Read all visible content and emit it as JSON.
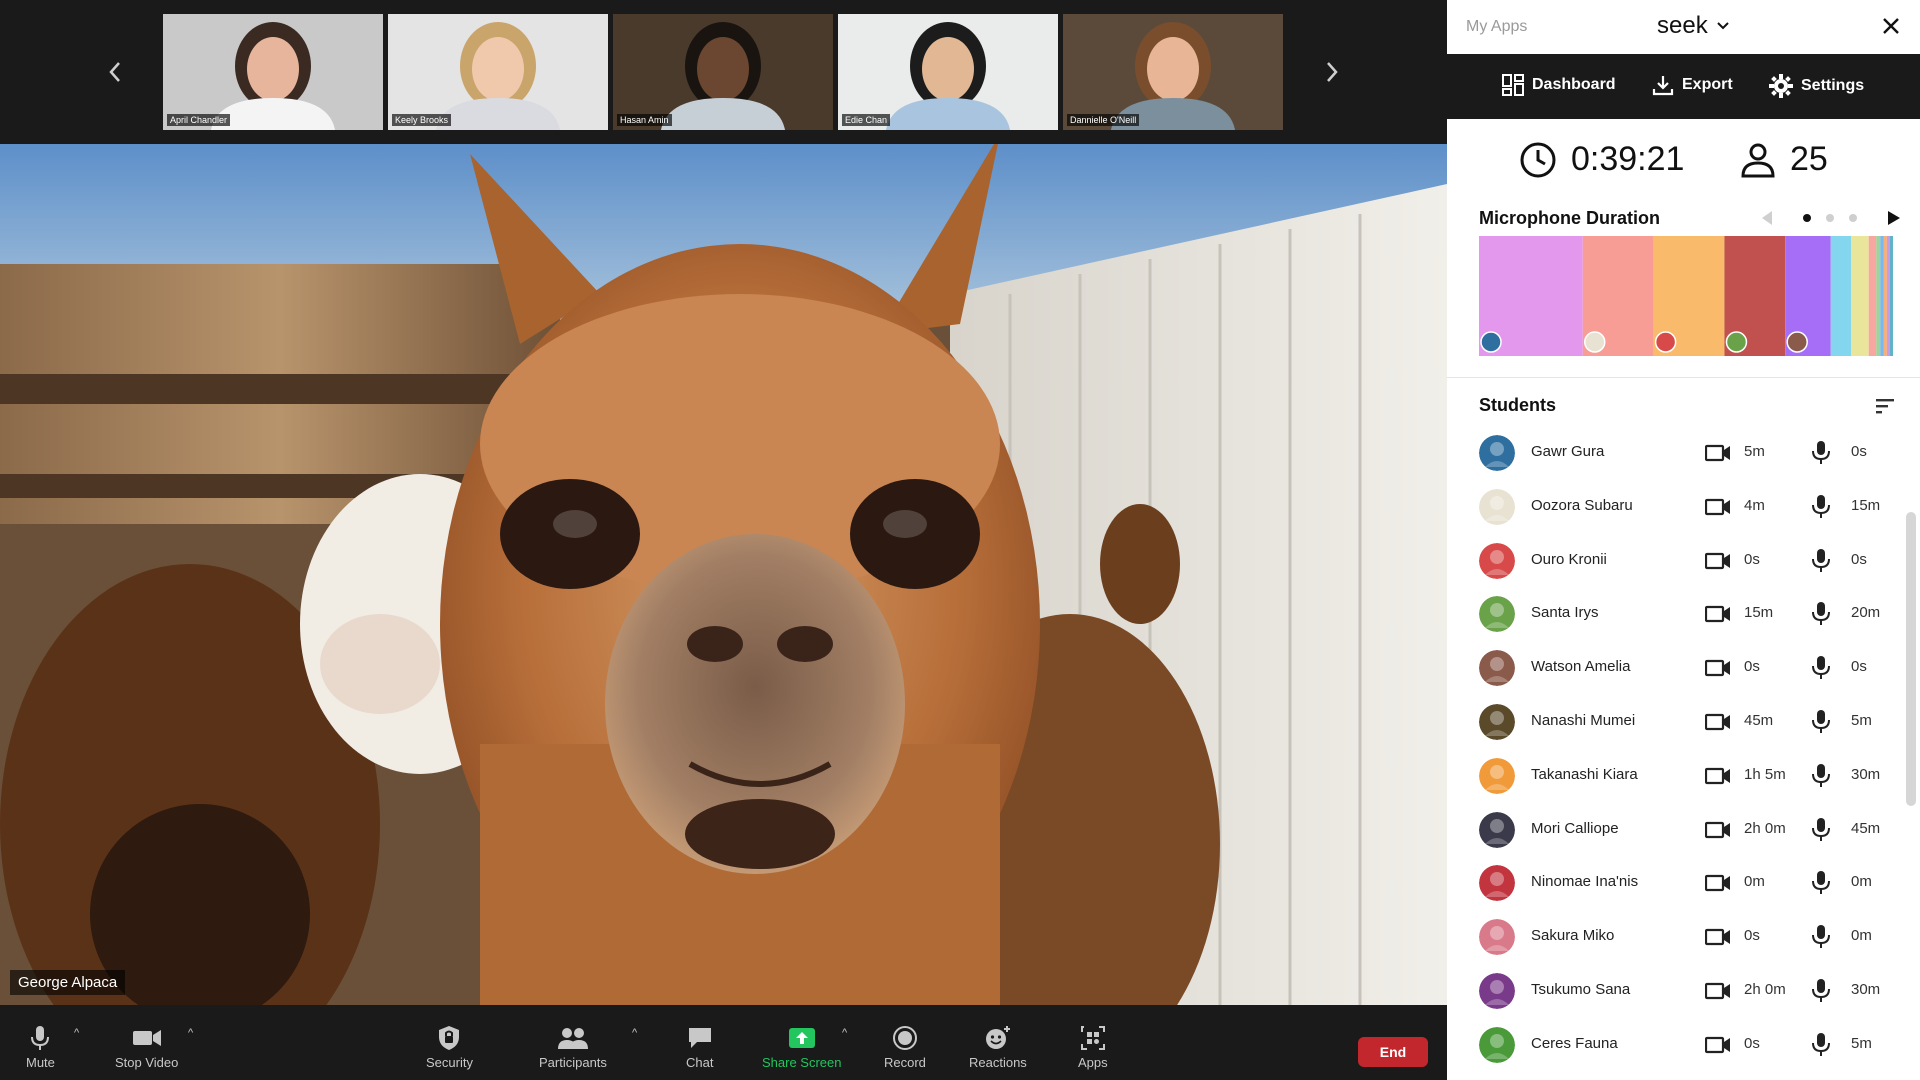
{
  "thumbnails": {
    "prev_icon": "chevron-left-icon",
    "next_icon": "chevron-right-icon",
    "items": [
      {
        "name": "April Chandler",
        "bg": "#c9c9c9",
        "hair": "#3a2a22",
        "skin": "#e6b59c",
        "shirt": "#f4f4f4"
      },
      {
        "name": "Keely Brooks",
        "bg": "#e4e4e4",
        "hair": "#c9a46b",
        "skin": "#f0c8ac",
        "shirt": "#d9dbe0"
      },
      {
        "name": "Hasan Amin",
        "bg": "#4a3a2c",
        "hair": "#1a1410",
        "skin": "#6b4630",
        "shirt": "#c7cfd6"
      },
      {
        "name": "Edie Chan",
        "bg": "#e9ecea",
        "hair": "#1c1c1c",
        "skin": "#e2b794",
        "shirt": "#a9c4df"
      },
      {
        "name": "Dannielle O'Neill",
        "bg": "#5b4a3a",
        "hair": "#7a4e2c",
        "skin": "#e8b597",
        "shirt": "#7b909c"
      }
    ]
  },
  "main_video": {
    "speaker": "George Alpaca"
  },
  "toolbar": {
    "mute": {
      "label": "Mute",
      "icon": "microphone-icon"
    },
    "stop_video": {
      "label": "Stop Video",
      "icon": "video-camera-icon"
    },
    "security": {
      "label": "Security",
      "icon": "shield-icon"
    },
    "participants": {
      "label": "Participants",
      "icon": "participants-icon"
    },
    "chat": {
      "label": "Chat",
      "icon": "chat-icon"
    },
    "share_screen": {
      "label": "Share Screen",
      "icon": "share-screen-icon",
      "color": "#22c55e"
    },
    "record": {
      "label": "Record",
      "icon": "record-icon"
    },
    "reactions": {
      "label": "Reactions",
      "icon": "smiley-icon"
    },
    "apps": {
      "label": "Apps",
      "icon": "apps-icon"
    },
    "end": {
      "label": "End",
      "color": "#c1272d"
    }
  },
  "panel": {
    "my_apps": "My Apps",
    "app_name": "seek",
    "nav": {
      "dashboard": "Dashboard",
      "export": "Export",
      "settings": "Settings"
    },
    "stats": {
      "elapsed": "0:39:21",
      "participants": "25"
    },
    "microphone_duration": {
      "title": "Microphone Duration",
      "active_page": 0,
      "pages": 3
    },
    "students_title": "Students"
  },
  "chart_data": {
    "type": "bar",
    "title": "Microphone Duration",
    "series": [
      {
        "share": 0.205,
        "color": "#e398ee"
      },
      {
        "share": 0.14,
        "color": "#f89d96"
      },
      {
        "share": 0.14,
        "color": "#f9bb6b"
      },
      {
        "share": 0.12,
        "color": "#c1514f"
      },
      {
        "share": 0.09,
        "color": "#a66ef6"
      },
      {
        "share": 0.04,
        "color": "#84d6ee"
      },
      {
        "share": 0.035,
        "color": "#e9e59a"
      },
      {
        "share": 0.015,
        "color": "#f7a6a0"
      },
      {
        "share": 0.008,
        "color": "#9bd49c"
      },
      {
        "share": 0.007,
        "color": "#7cb7f0"
      },
      {
        "share": 0.006,
        "color": "#f5b07a"
      },
      {
        "share": 0.006,
        "color": "#c79be8"
      },
      {
        "share": 0.006,
        "color": "#5fb4c8"
      }
    ]
  },
  "students": [
    {
      "name": "Gawr Gura",
      "camera": "5m",
      "mic": "0s",
      "avatar": "#2f6fa0"
    },
    {
      "name": "Oozora Subaru",
      "camera": "4m",
      "mic": "15m",
      "avatar": "#e8e2d2"
    },
    {
      "name": "Ouro Kronii",
      "camera": "0s",
      "mic": "0s",
      "avatar": "#d84a4a"
    },
    {
      "name": "Santa Irys",
      "camera": "15m",
      "mic": "20m",
      "avatar": "#6aa24a"
    },
    {
      "name": "Watson Amelia",
      "camera": "0s",
      "mic": "0s",
      "avatar": "#8a5a4a"
    },
    {
      "name": "Nanashi Mumei",
      "camera": "45m",
      "mic": "5m",
      "avatar": "#5a4a2a"
    },
    {
      "name": "Takanashi Kiara",
      "camera": "1h 5m",
      "mic": "30m",
      "avatar": "#f09a3a"
    },
    {
      "name": "Mori Calliope",
      "camera": "2h 0m",
      "mic": "45m",
      "avatar": "#3a3a4a"
    },
    {
      "name": "Ninomae Ina'nis",
      "camera": "0m",
      "mic": "0m",
      "avatar": "#c2353f"
    },
    {
      "name": "Sakura Miko",
      "camera": "0s",
      "mic": "0m",
      "avatar": "#d97a8a"
    },
    {
      "name": "Tsukumo Sana",
      "camera": "2h 0m",
      "mic": "30m",
      "avatar": "#7a3a8a"
    },
    {
      "name": "Ceres Fauna",
      "camera": "0s",
      "mic": "5m",
      "avatar": "#4a9a3a"
    }
  ]
}
